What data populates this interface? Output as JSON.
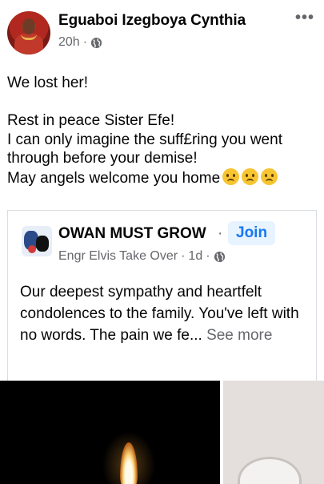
{
  "post": {
    "author": "Eguaboi Izegboya Cynthia",
    "time": "20h",
    "separator": "·",
    "privacy_icon": "globe-icon",
    "more_icon": "more-icon",
    "lines": [
      "We lost her!",
      "",
      "Rest in peace Sister Efe!",
      "I can only imagine the suff£ring you went",
      "through before your demise!",
      "May angels welcome you home"
    ],
    "emoji": "frowning-face-icon",
    "emoji_count": 3
  },
  "shared": {
    "group_name": "OWAN MUST GROW",
    "separator": "·",
    "join_label": "Join",
    "poster": "Engr Elvis Take Over",
    "time": "1d",
    "text": "Our deepest sympathy and heartfelt condolences to the family. You've left with no words. The pain we fe...",
    "see_more": "See more"
  },
  "colors": {
    "text": "#050505",
    "secondary": "#65676b",
    "accent": "#1877f2",
    "join_bg": "#e7f3ff"
  }
}
